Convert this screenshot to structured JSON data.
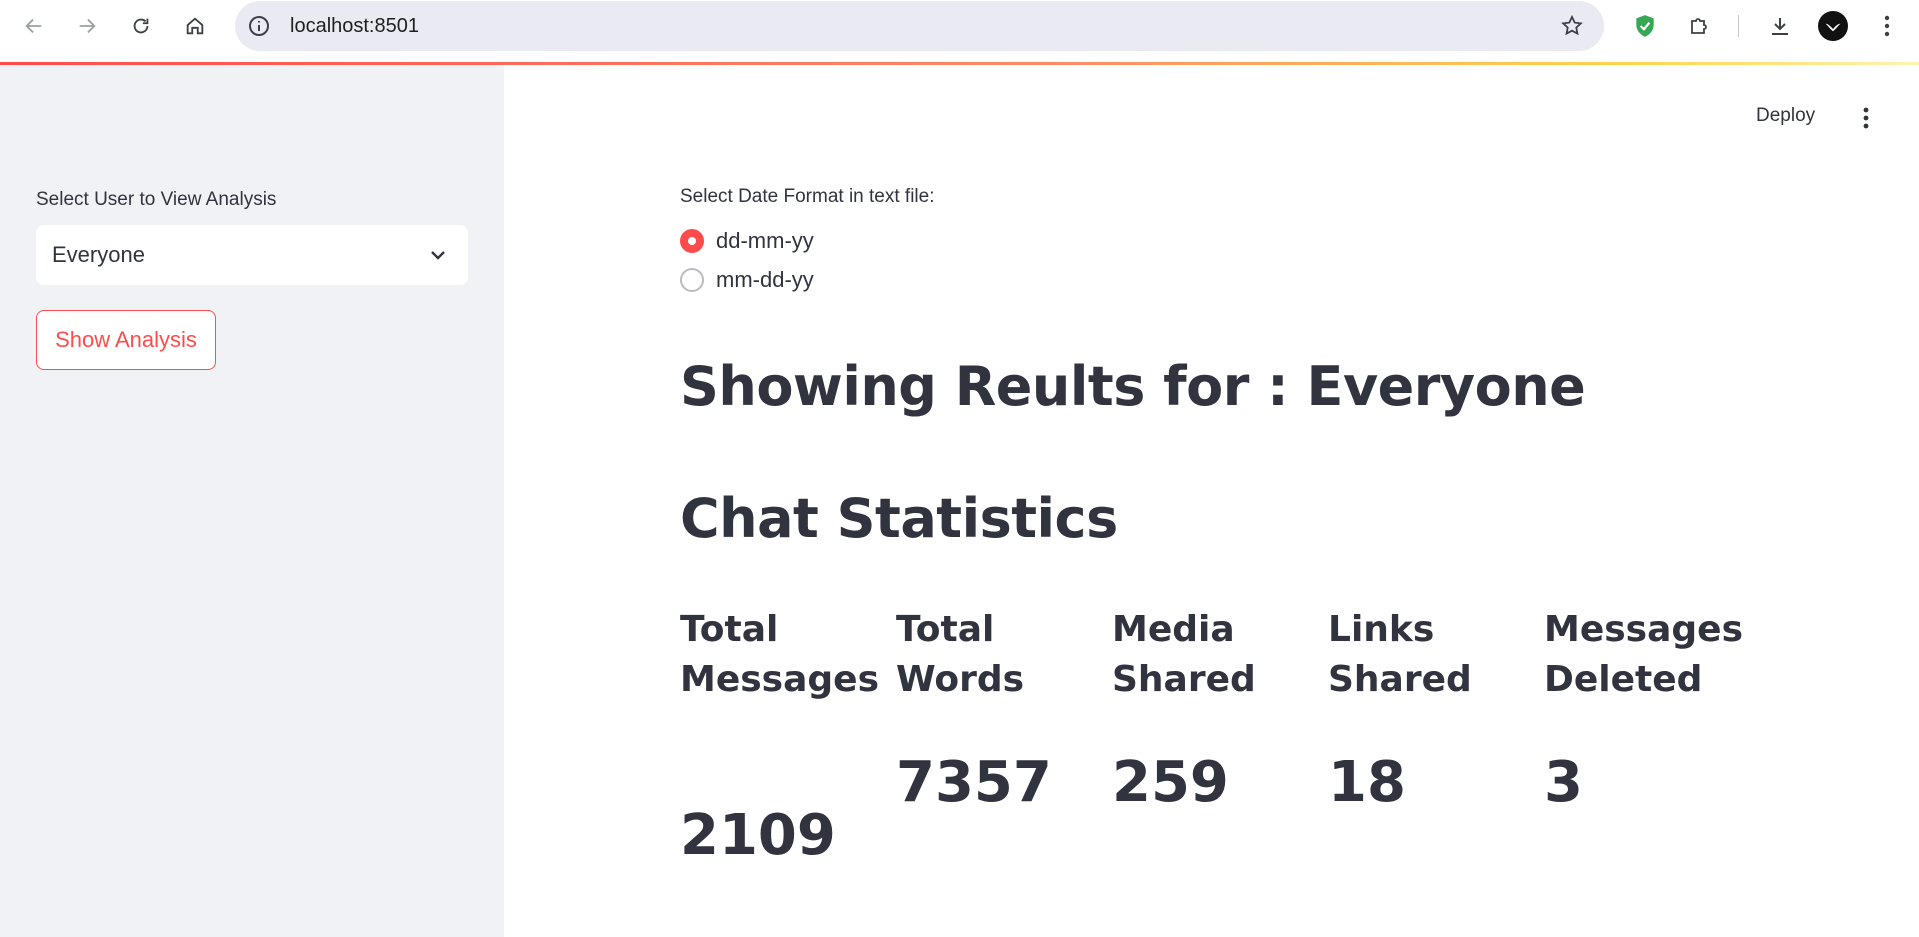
{
  "browser": {
    "url": "localhost:8501"
  },
  "sidebar": {
    "select_label": "Select User to View Analysis",
    "select_value": "Everyone",
    "show_button": "Show Analysis"
  },
  "header": {
    "deploy_label": "Deploy"
  },
  "main": {
    "radio_label": "Select Date Format in text file:",
    "radio_options": [
      {
        "label": "dd-mm-yy",
        "checked": true
      },
      {
        "label": "mm-dd-yy",
        "checked": false
      }
    ],
    "results_title": "Showing Reults for : Everyone",
    "stats_title": "Chat Statistics",
    "stats": [
      {
        "label_line1": "Total",
        "label_line2": "Messages",
        "value": "2109"
      },
      {
        "label_line1": "Total",
        "label_line2": "Words",
        "value": "7357"
      },
      {
        "label_line1": "Media",
        "label_line2": "Shared",
        "value": "259"
      },
      {
        "label_line1": "Links",
        "label_line2": "Shared",
        "value": "18"
      },
      {
        "label_line1": "Messages",
        "label_line2": "Deleted",
        "value": "3"
      }
    ]
  },
  "colors": {
    "accent": "#ff4b4b",
    "text": "#31333f",
    "sidebar_bg": "#f0f2f6"
  }
}
